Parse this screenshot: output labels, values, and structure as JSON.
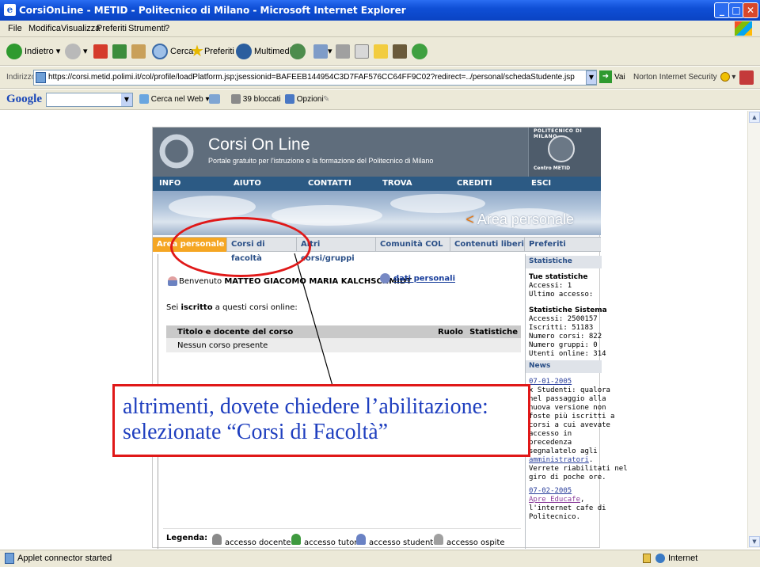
{
  "window": {
    "title": "CorsiOnLine - METID - Politecnico di Milano - Microsoft Internet Explorer"
  },
  "menu": [
    "File",
    "Modifica",
    "Visualizza",
    "Preferiti",
    "Strumenti",
    "?"
  ],
  "toolbar": {
    "back": "Indietro",
    "search": "Cerca",
    "favorites": "Preferiti",
    "media": "Multimedia"
  },
  "address": {
    "label": "Indirizzo",
    "url": "https://corsi.metid.polimi.it/col/profile/loadPlatform.jsp;jsessionid=BAFEEB144954C3D7FAF576CC64FF9C02?redirect=../personal/schedaStudente.jsp",
    "go": "Vai",
    "norton": "Norton Internet Security"
  },
  "google_bar": {
    "logo": "Google",
    "search_web": "Cerca nel Web",
    "blocked": "39 bloccati",
    "options": "Opzioni"
  },
  "site": {
    "title": "Corsi On Line",
    "subtitle": "Portale gratuito per l'istruzione e la formazione del Politecnico di Milano",
    "poli_name": "POLITECNICO DI MILANO",
    "metid": "Centro METID",
    "area_prefix": "<",
    "area_title": "Area personale",
    "top_nav": [
      "INFO",
      "AIUTO",
      "CONTATTI",
      "TROVA",
      "CREDITI",
      "ESCI"
    ],
    "sub_nav": [
      "Area personale",
      "Corsi di facoltà",
      "Altri corsi/gruppi",
      "Comunità COL",
      "Contenuti liberi",
      "Preferiti"
    ],
    "welcome": "Benvenuto",
    "user": "MATTEO GIACOMO MARIA KALCHSCHMIDT",
    "dati": "dati personali",
    "iscritto_pre": "Sei",
    "iscritto_bold": "iscritto",
    "iscritto_post": "a questi corsi online:",
    "table": {
      "headers": [
        "Titolo e docente del corso",
        "Ruolo",
        "Statistiche"
      ],
      "empty": "Nessun corso presente"
    },
    "legend": {
      "label": "Legenda:",
      "items": [
        "accesso docente",
        "accesso tutor",
        "accesso studente",
        "accesso ospite"
      ]
    },
    "side": {
      "stat_header": "Statistiche",
      "tue": "Tue statistiche",
      "accessi": "Accessi: 1",
      "ultimo": "Ultimo accesso:",
      "sistema": "Statistiche Sistema",
      "sys_lines": [
        "Accessi: 2500157",
        "Iscritti: 51183",
        "Numero corsi: 822",
        "Numero gruppi: 0",
        "Utenti online: 314"
      ],
      "news_header": "News",
      "news1_date": "07-01-2005",
      "news1_lines": [
        "x Studenti: qualora",
        "nel passaggio alla",
        "nuova versione non",
        "foste più iscritti a",
        "corsi a cui avevate",
        "accesso in",
        "precedenza",
        "segnalatelo agli"
      ],
      "news1_link": "amministratori",
      "news1_tail": [
        "Verrete riabilitati nel",
        "giro di poche ore."
      ],
      "news2_date": "07-02-2005",
      "news2_link": "Apre Educafe",
      "news2_lines": [
        "l'internet cafe di",
        "Politecnico."
      ]
    }
  },
  "annotation": {
    "line1": "altrimenti, dovete chiedere l’abilitazione:",
    "line2": "selezionate “Corsi di Facoltà”"
  },
  "status": {
    "left": "Applet connector started",
    "zone": "Internet"
  },
  "colors": {
    "xp_blue": "#0a43c3",
    "nav_blue": "#2c5a84",
    "annotation_red": "#e01818",
    "annotation_text": "#1f3fbf",
    "active_tab": "#f5a623"
  }
}
